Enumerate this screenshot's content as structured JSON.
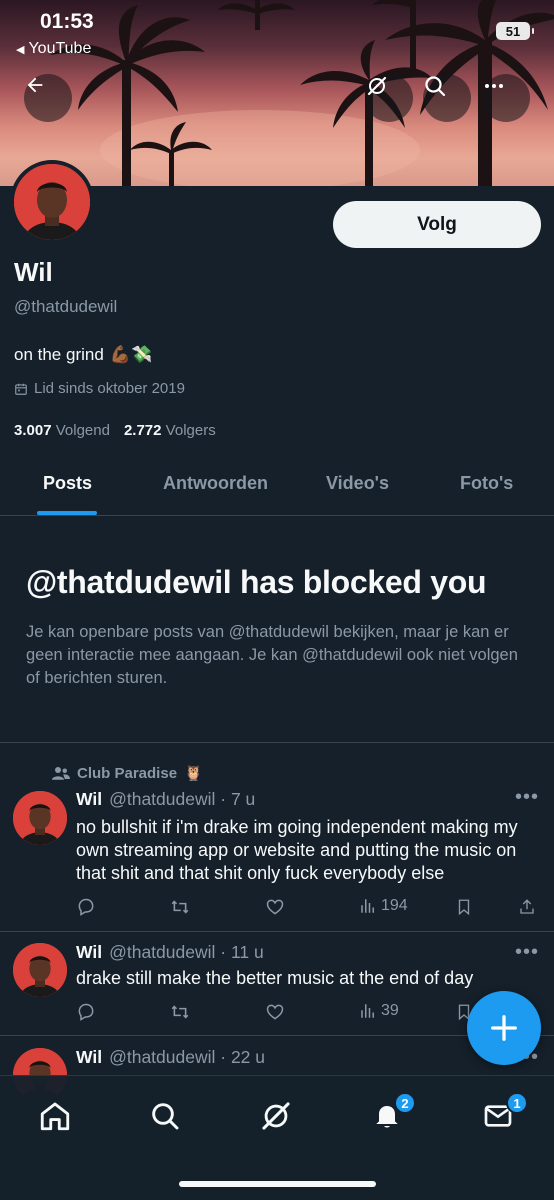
{
  "status_bar": {
    "time": "01:53",
    "back_app": "YouTube",
    "battery": "51"
  },
  "header": {
    "back_icon": "arrow-left-icon",
    "actions": [
      "grok-icon",
      "search-icon",
      "more-icon"
    ]
  },
  "profile": {
    "follow_label": "Volg",
    "display_name": "Wil",
    "handle": "@thatdudewil",
    "bio": "on the grind",
    "bio_emoji": "💪🏾💸",
    "joined": "Lid sinds oktober 2019",
    "following_count": "3.007",
    "following_label": "Volgend",
    "followers_count": "2.772",
    "followers_label": "Volgers"
  },
  "tabs": [
    {
      "label": "Posts",
      "active": true
    },
    {
      "label": "Antwoorden",
      "active": false
    },
    {
      "label": "Video's",
      "active": false
    },
    {
      "label": "Foto's",
      "active": false
    }
  ],
  "blocked": {
    "title": "@thatdudewil has blocked you",
    "description": "Je kan openbare posts van @thatdudewil bekijken, maar je kan er geen interactie mee aangaan. Je kan @thatdudewil ook niet volgen of berichten sturen."
  },
  "tweets": [
    {
      "community": "Club Paradise",
      "community_emoji": "🦉",
      "name": "Wil",
      "meta": "@thatdudewil · 7 u",
      "text": "no bullshit if i'm drake im going independent making my own streaming app or website and putting the music on that shit and that shit only fuck everybody else",
      "views": "194"
    },
    {
      "name": "Wil",
      "meta": "@thatdudewil · 11 u",
      "text": "drake still make the better music at the end of day",
      "views": "39"
    },
    {
      "name": "Wil",
      "meta": "@thatdudewil · 22 u"
    }
  ],
  "bottom_nav": {
    "items": [
      "home-icon",
      "search-icon",
      "grok-icon",
      "notifications-icon",
      "messages-icon"
    ],
    "notifications_badge": "2",
    "messages_badge": "1"
  },
  "colors": {
    "background": "#15202b",
    "accent": "#1d9bf0",
    "muted": "#8b98a5",
    "divider": "#38444d"
  }
}
